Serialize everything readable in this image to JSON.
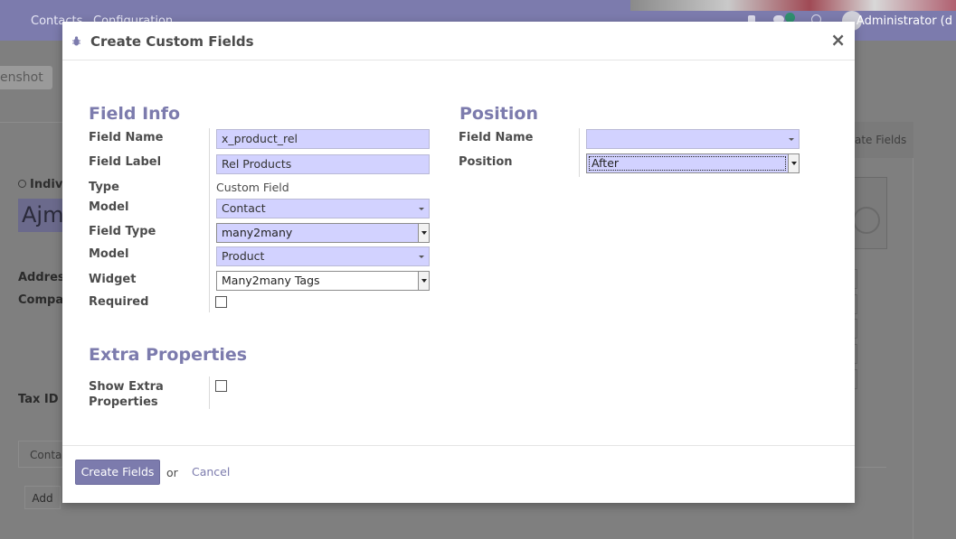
{
  "background": {
    "menu": [
      "Contacts",
      "Configuration"
    ],
    "user": "Administrator (d",
    "screenshot_button": "enshot",
    "individual_label": "Indiv",
    "name_value": "Ajm",
    "labels": [
      "Address",
      "Compar",
      "Tax ID"
    ],
    "create_fields_tab": "ate Fields",
    "tab_contacts": "Contac",
    "add_button": "Add"
  },
  "modal": {
    "title": "Create Custom Fields",
    "close": "×",
    "field_info": {
      "heading": "Field Info",
      "field_name_label": "Field Name",
      "field_name_value": "x_product_rel",
      "field_label_label": "Field Label",
      "field_label_value": "Rel Products",
      "type_label": "Type",
      "type_value": "Custom Field",
      "model_label": "Model",
      "model_value": "Contact",
      "field_type_label": "Field Type",
      "field_type_value": "many2many",
      "model2_label": "Model",
      "model2_value": "Product",
      "widget_label": "Widget",
      "widget_value": "Many2many Tags",
      "required_label": "Required",
      "required_checked": false
    },
    "position": {
      "heading": "Position",
      "field_name_label": "Field Name",
      "field_name_value": "",
      "position_label": "Position",
      "position_value": "After"
    },
    "extra": {
      "heading": "Extra Properties",
      "show_extra_label_line1": "Show Extra",
      "show_extra_label_line2": "Properties",
      "show_extra_checked": false
    },
    "footer": {
      "create_button": "Create Fields",
      "or_text": "or",
      "cancel_link": "Cancel"
    }
  },
  "colors": {
    "accent": "#7c7bad",
    "input_bg": "#d2d2ff"
  }
}
